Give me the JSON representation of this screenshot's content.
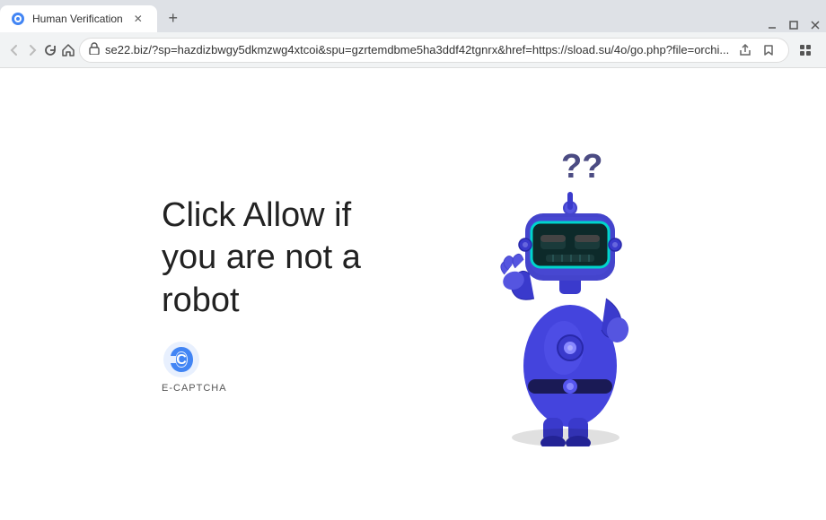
{
  "browser": {
    "tab": {
      "title": "Human Verification",
      "favicon": "🌐"
    },
    "new_tab_label": "+",
    "window_controls": {
      "minimize": "–",
      "maximize": "□",
      "close": "✕"
    },
    "toolbar": {
      "back_label": "←",
      "forward_label": "→",
      "refresh_label": "↻",
      "home_label": "⌂",
      "address": "se22.biz/?sp=hazdizbwgy5dkmzwg4xtcoi&spu=gzrtemdbme5ha3ddf42tgnrx&href=https://sload.su/4o/go.php?file=orchi...",
      "share_label": "⬆",
      "bookmark_label": "☆",
      "extensions_label": "🧩",
      "profile_label": "👤",
      "menu_label": "⋮"
    }
  },
  "page": {
    "main_text": "Click Allow if you are not a robot",
    "captcha_label": "E-CAPTCHA"
  }
}
